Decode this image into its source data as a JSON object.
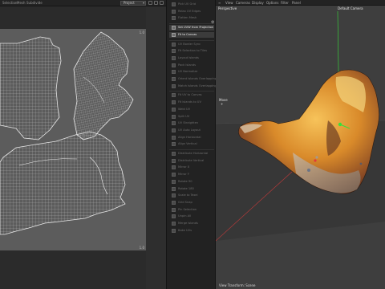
{
  "uv_editor": {
    "menu": [
      "Selection",
      "Mesh",
      "Subdivide"
    ],
    "dropdown_value": "Project",
    "corner_top": "1.0",
    "corner_bottom": "1.0"
  },
  "tools_panel": {
    "items": [
      "Pick UV Grid",
      "Relax UV Edges",
      "Flatten Mesh",
      "Set UVW from Projection",
      "Fit to Canvas",
      "UV Border Sync",
      "Fit Selection to Tiles",
      "Layout Islands",
      "Pack Islands",
      "UV Normalize",
      "Orient Islands Overlapping",
      "Match Islands Overlapping",
      "Fit UV to Canvas",
      "Fit Islands to UV",
      "Weld UV",
      "Split UV",
      "UV Straighten",
      "UV Auto Layout",
      "Align Horizontal",
      "Align Vertical",
      "Distribute Horizontal",
      "Distribute Vertical",
      "Mirror X",
      "Mirror Y",
      "Rotate 90",
      "Rotate 180",
      "Scale to Texel",
      "Grid Snap",
      "Pin Selection",
      "Unpin All",
      "Merge Islands",
      "Bake UVs"
    ],
    "active_index": [
      3,
      4
    ]
  },
  "viewport": {
    "menu": [
      "View",
      "Cameras",
      "Display",
      "Options",
      "Filter",
      "Panel"
    ],
    "view_name": "Perspective",
    "camera_name": "Default Camera",
    "hud_label": "Move",
    "status": "View Transform: Scene"
  },
  "colors": {
    "viewport_bg": "#3e3e3e",
    "uv_canvas_bg": "#5c5c5c",
    "accent_green": "#37e03a"
  }
}
